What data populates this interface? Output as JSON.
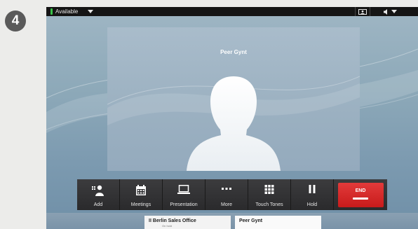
{
  "step": {
    "number": "4"
  },
  "statusbar": {
    "availability": "Available",
    "availability_color": "#39c24a"
  },
  "video": {
    "participant_name": "Peer Gynt"
  },
  "toolbar": {
    "buttons": [
      {
        "label": "Add",
        "icon": "add-participant-icon"
      },
      {
        "label": "Meetings",
        "icon": "calendar-icon"
      },
      {
        "label": "Presentation",
        "icon": "laptop-icon"
      },
      {
        "label": "More",
        "icon": "ellipsis-icon"
      },
      {
        "label": "Touch Tones",
        "icon": "keypad-icon"
      },
      {
        "label": "Hold",
        "icon": "pause-icon"
      }
    ],
    "end": {
      "label": "END",
      "color": "#d42626",
      "icon": "end-call-icon"
    }
  },
  "calls": [
    {
      "name": "Berlin Sales Office",
      "status": "On hold",
      "state_icon": "pause-icon"
    },
    {
      "name": "Peer Gynt"
    }
  ]
}
